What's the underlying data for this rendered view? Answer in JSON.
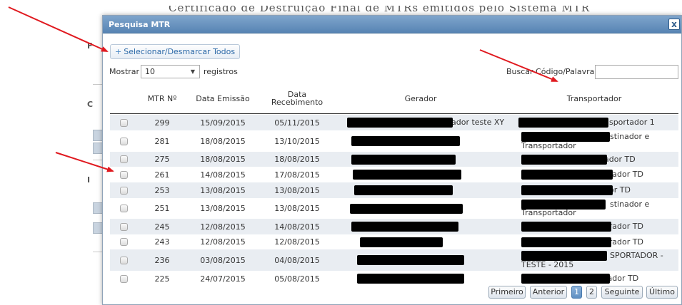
{
  "background": {
    "title": "Certificado de Destruição Final de MTRs emitidos pelo Sistema MTR",
    "edge_letters": [
      "F",
      "C",
      "I"
    ]
  },
  "dialog": {
    "title": "Pesquisa MTR",
    "close_label": "x",
    "select_all_label": "Selecionar/Desmarcar Todos",
    "show_label": "Mostrar",
    "show_value": "10",
    "records_label": "registros",
    "search_label": "Buscar Código/Palavra:",
    "search_value": ""
  },
  "table": {
    "headers": [
      "MTR Nº",
      "Data Emissão",
      "Data Recebimento",
      "Gerador",
      "Transportador"
    ],
    "rows": [
      {
        "mtr": "299",
        "emissao": "15/09/2015",
        "recebimento": "05/11/2015",
        "gerador": "Gerador teste XY",
        "gerador_visible": "ador teste XY",
        "transp_l1": "nsportador 1",
        "transp_l2": ""
      },
      {
        "mtr": "281",
        "emissao": "18/08/2015",
        "recebimento": "13/10/2015",
        "gerador": "",
        "gerador_visible": "",
        "transp_l1": "stinador e",
        "transp_l2": "Transportador"
      },
      {
        "mtr": "275",
        "emissao": "18/08/2015",
        "recebimento": "18/08/2015",
        "gerador": "",
        "gerador_visible": "",
        "transp_l1": "ador TD",
        "transp_l2": ""
      },
      {
        "mtr": "261",
        "emissao": "14/08/2015",
        "recebimento": "17/08/2015",
        "gerador": "",
        "gerador_visible": "",
        "transp_l1": "erador TD",
        "transp_l2": ""
      },
      {
        "mtr": "253",
        "emissao": "13/08/2015",
        "recebimento": "13/08/2015",
        "gerador": "",
        "gerador_visible": "",
        "transp_l1": "dor TD",
        "transp_l2": ""
      },
      {
        "mtr": "251",
        "emissao": "13/08/2015",
        "recebimento": "13/08/2015",
        "gerador": "",
        "gerador_visible": "",
        "transp_l1": "stinador e",
        "transp_l2": "Transportador"
      },
      {
        "mtr": "245",
        "emissao": "12/08/2015",
        "recebimento": "14/08/2015",
        "gerador": "",
        "gerador_visible": "",
        "transp_l1": "erador TD",
        "transp_l2": ""
      },
      {
        "mtr": "243",
        "emissao": "12/08/2015",
        "recebimento": "12/08/2015",
        "gerador": "",
        "gerador_visible": "",
        "transp_l1": "erador TD",
        "transp_l2": ""
      },
      {
        "mtr": "236",
        "emissao": "03/08/2015",
        "recebimento": "04/08/2015",
        "gerador": "",
        "gerador_visible": "",
        "transp_l1": "SPORTADOR -",
        "transp_l2": "TESTE - 2015"
      },
      {
        "mtr": "225",
        "emissao": "24/07/2015",
        "recebimento": "05/08/2015",
        "gerador": "",
        "gerador_visible": "",
        "transp_l1": "rador TD",
        "transp_l2": ""
      }
    ]
  },
  "pagination": {
    "first": "Primeiro",
    "previous": "Anterior",
    "pages": [
      "1",
      "2"
    ],
    "current_page": "1",
    "next": "Seguinte",
    "last": "Último"
  },
  "colors": {
    "header_bar": "#5784b3",
    "row_odd": "#e9edf2",
    "annotation_arrow": "#e0191f",
    "link_blue": "#2d6aa8"
  },
  "icons": {
    "close": "close-icon",
    "add": "plus-icon",
    "dropdown": "chevron-down-icon",
    "annotation": "red-arrow-icon"
  }
}
